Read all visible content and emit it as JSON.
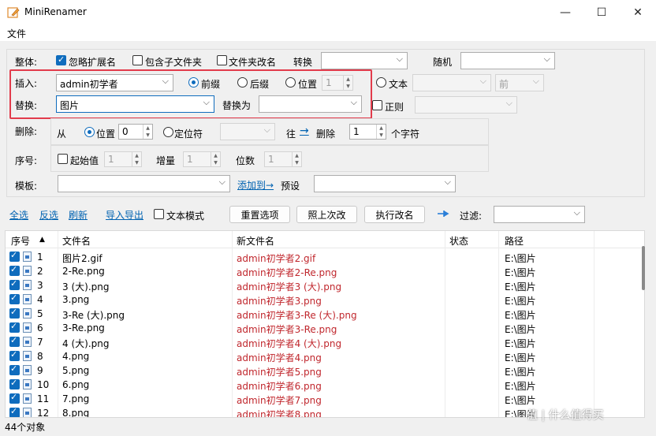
{
  "window": {
    "title": "MiniRenamer",
    "minimize": "—",
    "maximize": "☐",
    "close": "✕"
  },
  "menu": {
    "file": "文件"
  },
  "whole": {
    "label": "整体:",
    "ignore_ext": "忽略扩展名",
    "ignore_ext_checked": true,
    "include_sub": "包含子文件夹",
    "include_sub_checked": false,
    "folder_rename": "文件夹改名",
    "folder_rename_checked": false,
    "convert_label": "转换",
    "convert_value": "",
    "random_label": "随机",
    "random_value": ""
  },
  "insert": {
    "label": "插入:",
    "value": "admin初学者",
    "prefix": "前缀",
    "suffix": "后缀",
    "position": "位置",
    "position_value": "1",
    "selected": "prefix",
    "text_label": "文本",
    "text_value": "",
    "front_value": "前"
  },
  "replace": {
    "label": "替换:",
    "value": "图片",
    "with_label": "替换为",
    "with_value": "",
    "regex_label": "正则",
    "regex_value": ""
  },
  "delete": {
    "label": "删除:",
    "from": "从",
    "position": "位置",
    "position_value": "0",
    "locator": "定位符",
    "locator_value": "",
    "to": "往",
    "arrow": "→",
    "delete": "删除",
    "count_value": "1",
    "chars": "个字符"
  },
  "sequence": {
    "label": "序号:",
    "start": "起始值",
    "start_value": "1",
    "increment": "增量",
    "increment_value": "1",
    "digits": "位数",
    "digits_value": "1"
  },
  "template": {
    "label": "模板:",
    "value": "",
    "add_to": "添加到→",
    "preset": "预设",
    "preset_value": ""
  },
  "toolbar": {
    "select_all": "全选",
    "invert": "反选",
    "refresh": "刷新",
    "import_export": "导入导出",
    "text_mode": "文本模式",
    "reset": "重置选项",
    "last": "照上次改",
    "execute": "执行改名",
    "filter_label": "过滤:",
    "filter_value": ""
  },
  "table": {
    "headers": {
      "seq": "序号",
      "sort": "▲",
      "filename": "文件名",
      "newname": "新文件名",
      "state": "状态",
      "path": "路径"
    },
    "rows": [
      {
        "seq": "1",
        "name": "图片2.gif",
        "new": "admin初学者2.gif",
        "path": "E:\\图片"
      },
      {
        "seq": "2",
        "name": "2-Re.png",
        "new": "admin初学者2-Re.png",
        "path": "E:\\图片"
      },
      {
        "seq": "3",
        "name": "3 (大).png",
        "new": "admin初学者3 (大).png",
        "path": "E:\\图片"
      },
      {
        "seq": "4",
        "name": "3.png",
        "new": "admin初学者3.png",
        "path": "E:\\图片"
      },
      {
        "seq": "5",
        "name": "3-Re (大).png",
        "new": "admin初学者3-Re (大).png",
        "path": "E:\\图片"
      },
      {
        "seq": "6",
        "name": "3-Re.png",
        "new": "admin初学者3-Re.png",
        "path": "E:\\图片"
      },
      {
        "seq": "7",
        "name": "4 (大).png",
        "new": "admin初学者4 (大).png",
        "path": "E:\\图片"
      },
      {
        "seq": "8",
        "name": "4.png",
        "new": "admin初学者4.png",
        "path": "E:\\图片"
      },
      {
        "seq": "9",
        "name": "5.png",
        "new": "admin初学者5.png",
        "path": "E:\\图片"
      },
      {
        "seq": "10",
        "name": "6.png",
        "new": "admin初学者6.png",
        "path": "E:\\图片"
      },
      {
        "seq": "11",
        "name": "7.png",
        "new": "admin初学者7.png",
        "path": "E:\\图片"
      },
      {
        "seq": "12",
        "name": "8.png",
        "new": "admin初学者8.png",
        "path": "E:\\图片"
      }
    ]
  },
  "status": {
    "count": "44个对象"
  },
  "watermark": "值 | 什么值得买"
}
